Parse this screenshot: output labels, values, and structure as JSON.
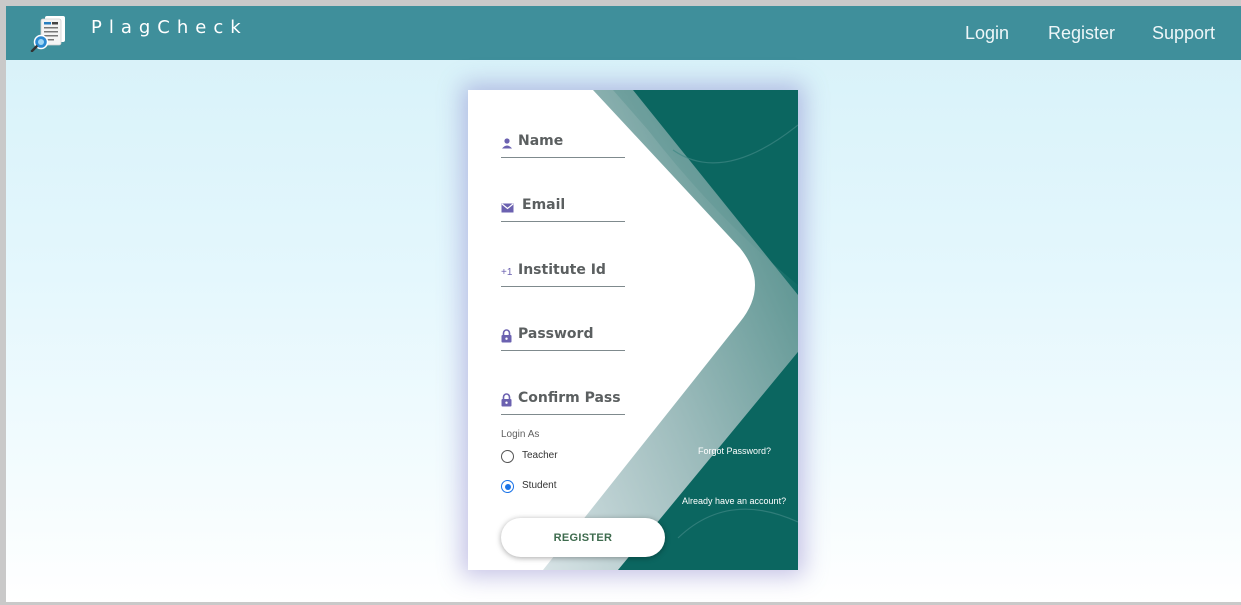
{
  "navbar": {
    "brand": "PlagCheck",
    "links": [
      "Login",
      "Register",
      "Support"
    ]
  },
  "form": {
    "fields": [
      {
        "icon": "person-icon",
        "label": "Name"
      },
      {
        "icon": "mail-icon",
        "label": "Email"
      },
      {
        "icon": "plus-one-icon",
        "label": "Institute Id",
        "icon_text": "+1"
      },
      {
        "icon": "lock-icon",
        "label": "Password"
      },
      {
        "icon": "lock-icon",
        "label": "Confirm Pass"
      }
    ],
    "login_as_label": "Login As",
    "roles": [
      {
        "label": "Teacher",
        "selected": false
      },
      {
        "label": "Student",
        "selected": true
      }
    ],
    "forgot_password": "Forgot Password?",
    "already_account": "Already have an account?",
    "submit_label": "REGISTER"
  },
  "colors": {
    "navbar": "#3f8f9b",
    "teal": "#0b6660",
    "icon": "#6b61b0",
    "radio_selected": "#1a73e8",
    "button_text": "#3e6b4e"
  }
}
